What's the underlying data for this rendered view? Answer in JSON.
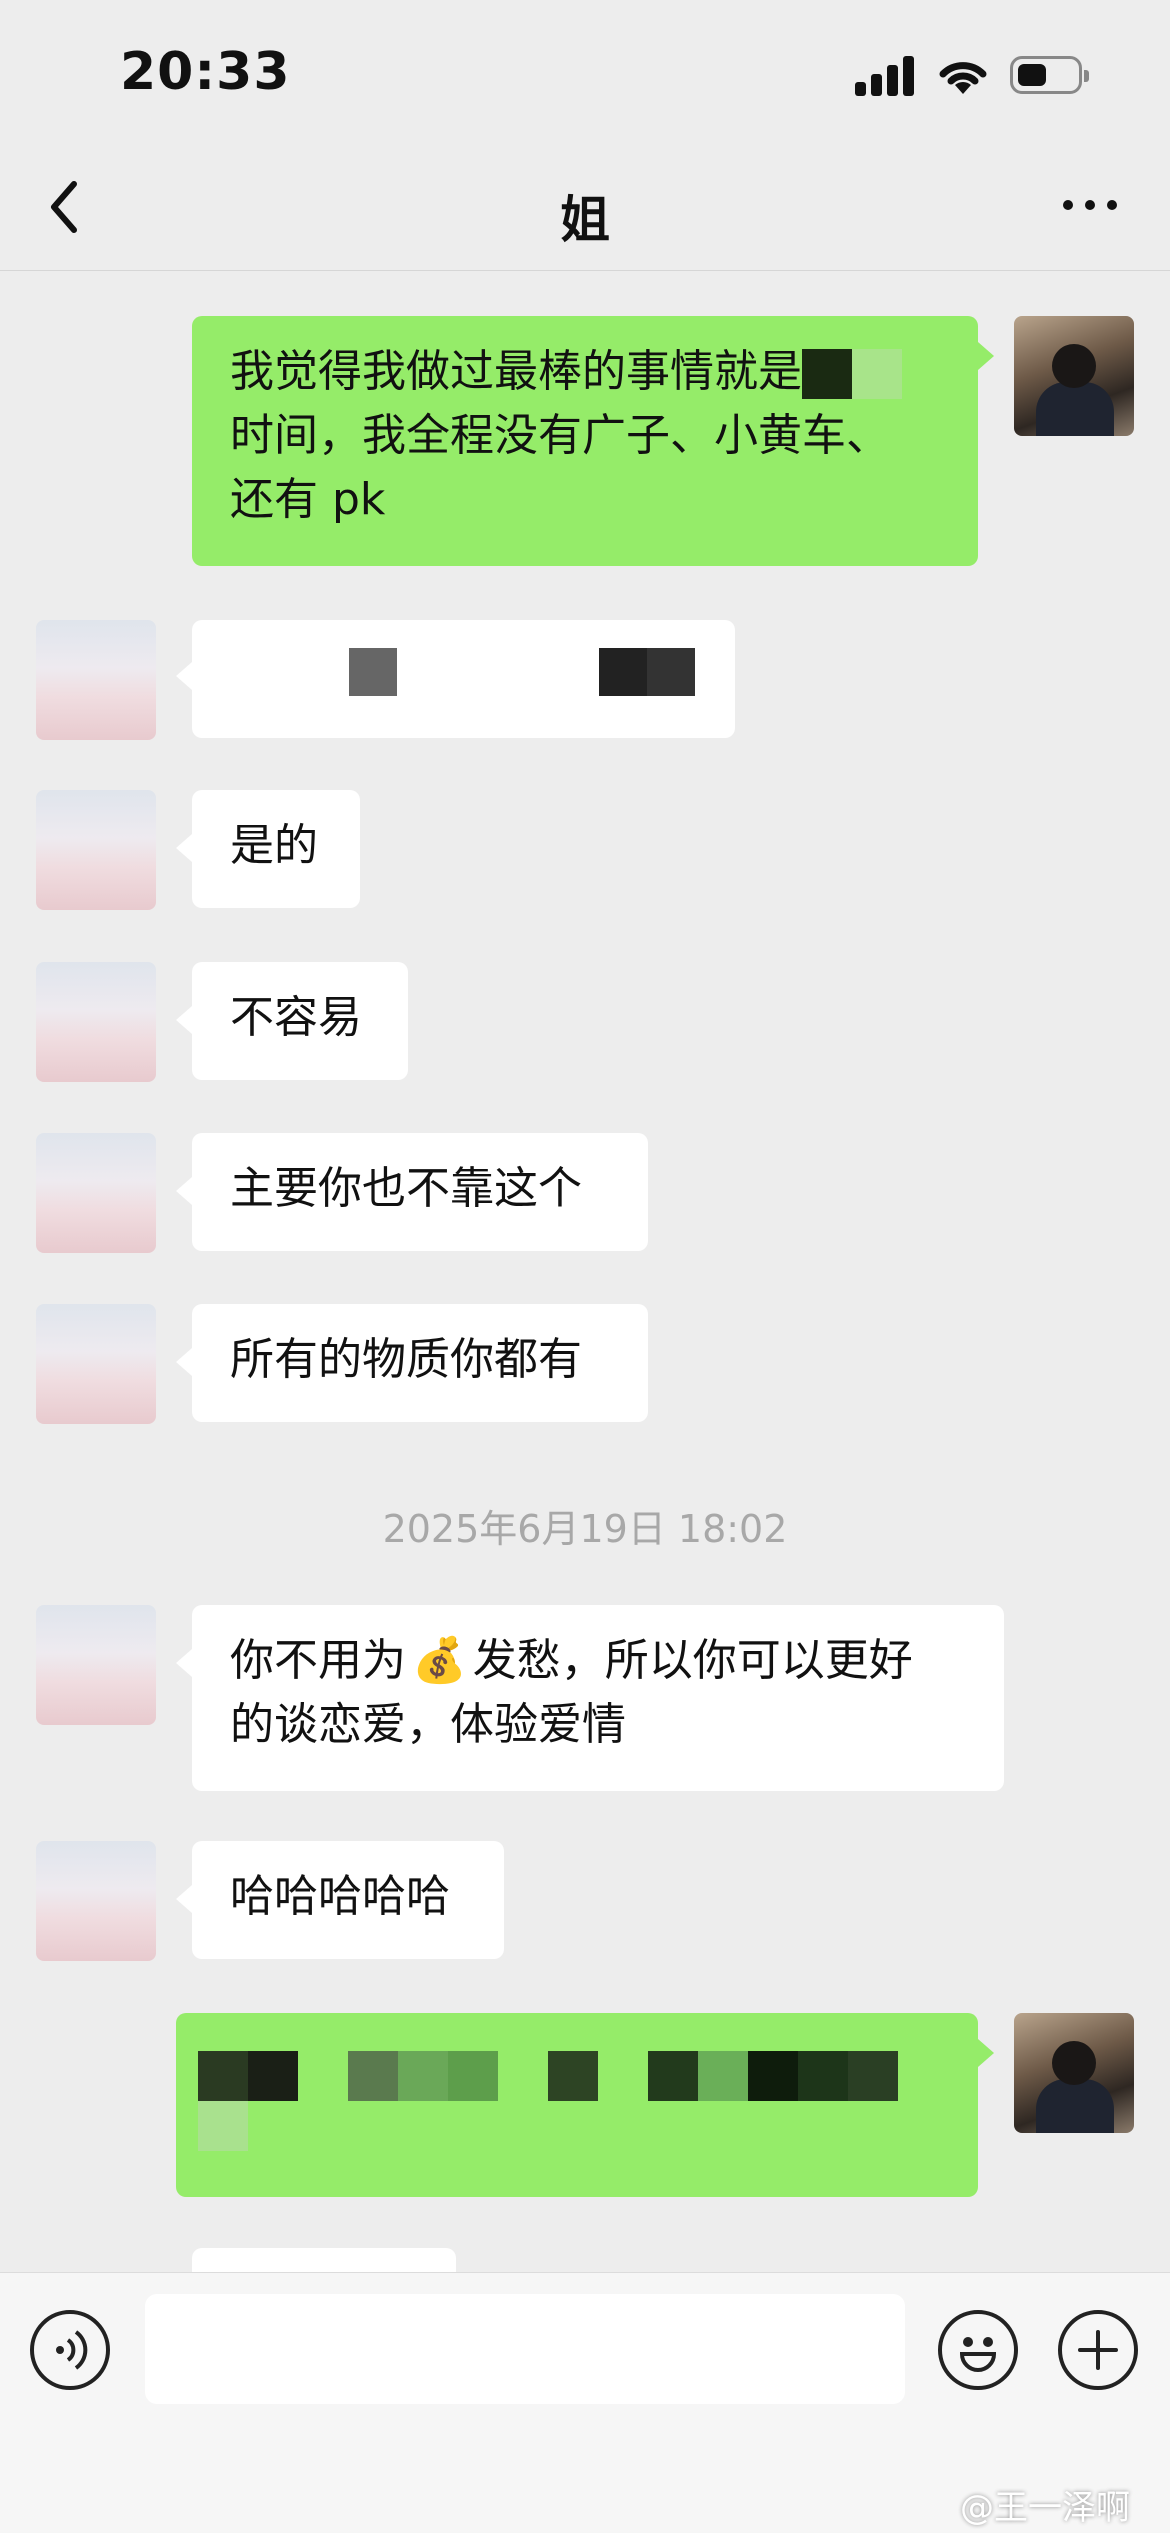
{
  "status_bar": {
    "time": "20:33"
  },
  "nav": {
    "title": "姐"
  },
  "messages": [
    {
      "text_line1": "我觉得我做过最棒的事情就是",
      "text_line2": "时间，我全程没有广子、小黄车、",
      "text_line3": "还有 pk"
    },
    {
      "text": "是的"
    },
    {
      "text": "不容易"
    },
    {
      "text": "主要你也不靠这个"
    },
    {
      "text": "所有的物质你都有"
    },
    {
      "timestamp": "2025年6月19日 18:02"
    },
    {
      "text_line1": "你不用为",
      "emoji": "💰",
      "text_line1b": "发愁，所以你可以更好",
      "text_line2": "的谈恋爱，体验爱情"
    },
    {
      "text": "哈哈哈哈哈"
    }
  ],
  "watermark": "@王一泽啊",
  "colors": {
    "sent_bubble": "#95ec69",
    "received_bubble": "#ffffff",
    "background": "#ededed"
  }
}
